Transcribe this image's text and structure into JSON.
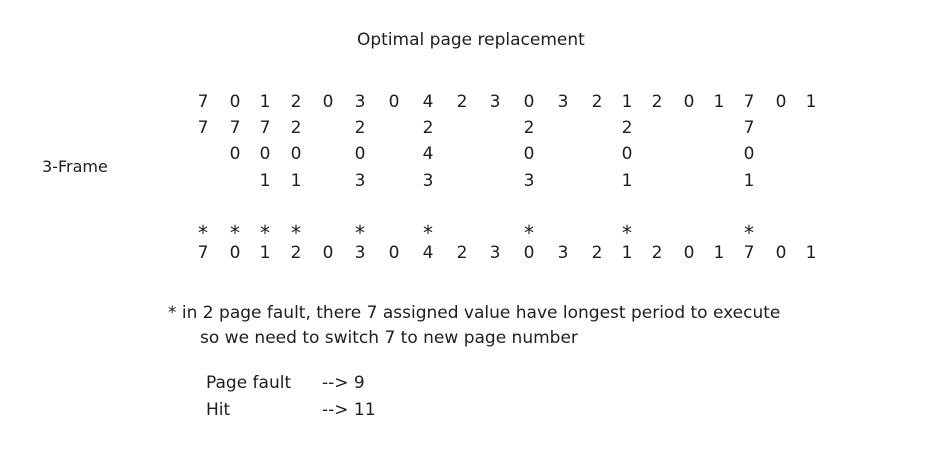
{
  "title": "Optimal page replacement",
  "frame_label": "3-Frame",
  "reference_string": [
    "7",
    "0",
    "1",
    "2",
    "0",
    "3",
    "0",
    "4",
    "2",
    "3",
    "0",
    "3",
    "2",
    "1",
    "2",
    "0",
    "1",
    "7",
    "0",
    "1"
  ],
  "frames": [
    [
      "7",
      "7",
      "7",
      "2",
      "",
      "2",
      "",
      "2",
      "",
      "",
      "2",
      "",
      "",
      "2",
      "",
      "",
      "",
      "7",
      "",
      ""
    ],
    [
      "",
      "0",
      "0",
      "0",
      "",
      "0",
      "",
      "4",
      "",
      "",
      "0",
      "",
      "",
      "0",
      "",
      "",
      "",
      "0",
      "",
      ""
    ],
    [
      "",
      "",
      "1",
      "1",
      "",
      "3",
      "",
      "3",
      "",
      "",
      "3",
      "",
      "",
      "1",
      "",
      "",
      "",
      "1",
      "",
      ""
    ]
  ],
  "fault_markers": [
    "*",
    "*",
    "*",
    "*",
    "",
    "*",
    "",
    "*",
    "",
    "",
    "*",
    "",
    "",
    "*",
    "",
    "",
    "",
    "*",
    "",
    ""
  ],
  "reference_string_repeat": [
    "7",
    "0",
    "1",
    "2",
    "0",
    "3",
    "0",
    "4",
    "2",
    "3",
    "0",
    "3",
    "2",
    "1",
    "2",
    "0",
    "1",
    "7",
    "0",
    "1"
  ],
  "note_line1": "* in 2 page fault, there 7 assigned value have longest period to execute",
  "note_line2": "so we need to switch 7 to new page number",
  "results": [
    {
      "label": "Page fault",
      "value": "--> 9"
    },
    {
      "label": "Hit",
      "value": "--> 11"
    }
  ]
}
